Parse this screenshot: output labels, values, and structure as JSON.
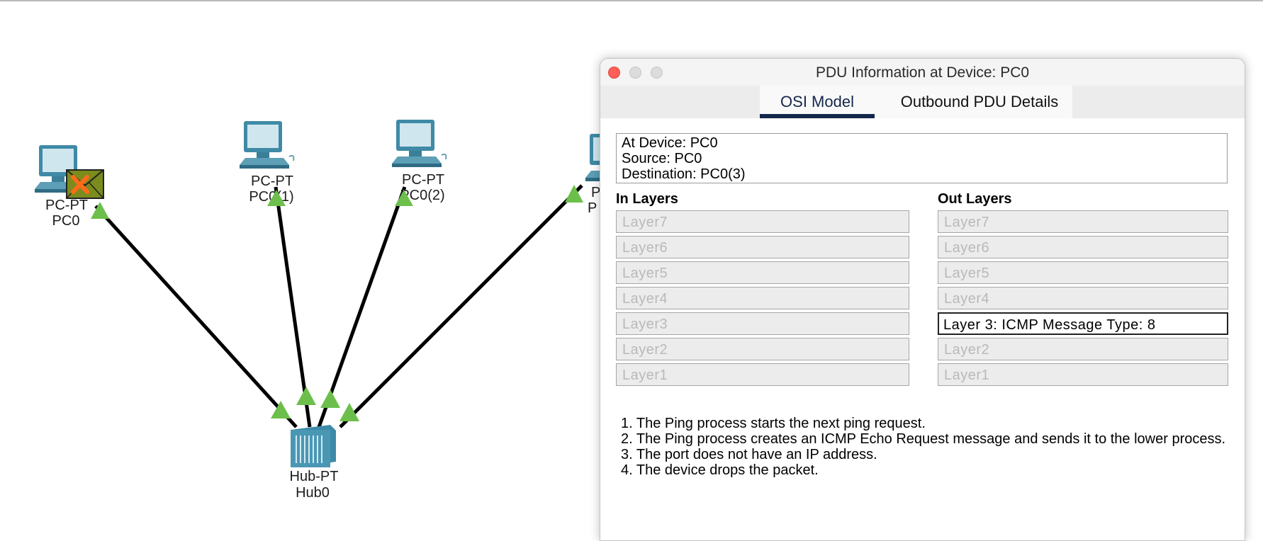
{
  "topology": {
    "devices": [
      {
        "id": "pc0",
        "type": "PC-PT",
        "name": "PC0"
      },
      {
        "id": "pc1",
        "type": "PC-PT",
        "name": "PC0(1)"
      },
      {
        "id": "pc2",
        "type": "PC-PT",
        "name": "PC0(2)"
      },
      {
        "id": "pc3",
        "type": "P",
        "name": "P"
      },
      {
        "id": "hub0",
        "type": "Hub-PT",
        "name": "Hub0"
      }
    ],
    "link_status_color": "#6cbf4b",
    "pdu_icon": "envelope-fail-icon"
  },
  "pdu_window": {
    "title": "PDU Information at Device: PC0",
    "tabs": {
      "osi": "OSI Model",
      "outbound": "Outbound PDU Details"
    },
    "info": {
      "at_device": "At Device: PC0",
      "source": "Source: PC0",
      "destination": "Destination: PC0(3)"
    },
    "in_layers": {
      "title": "In Layers",
      "items": [
        "Layer7",
        "Layer6",
        "Layer5",
        "Layer4",
        "Layer3",
        "Layer2",
        "Layer1"
      ]
    },
    "out_layers": {
      "title": "Out Layers",
      "items": [
        "Layer7",
        "Layer6",
        "Layer5",
        "Layer4",
        "Layer 3: ICMP Message Type: 8",
        "Layer2",
        "Layer1"
      ],
      "active_index": 4
    },
    "steps": [
      "1. The Ping process starts the next ping request.",
      "2. The Ping process creates an ICMP Echo Request message and sends it to the lower process.",
      "3. The port does not have an IP address.",
      "4. The device drops the packet."
    ]
  }
}
